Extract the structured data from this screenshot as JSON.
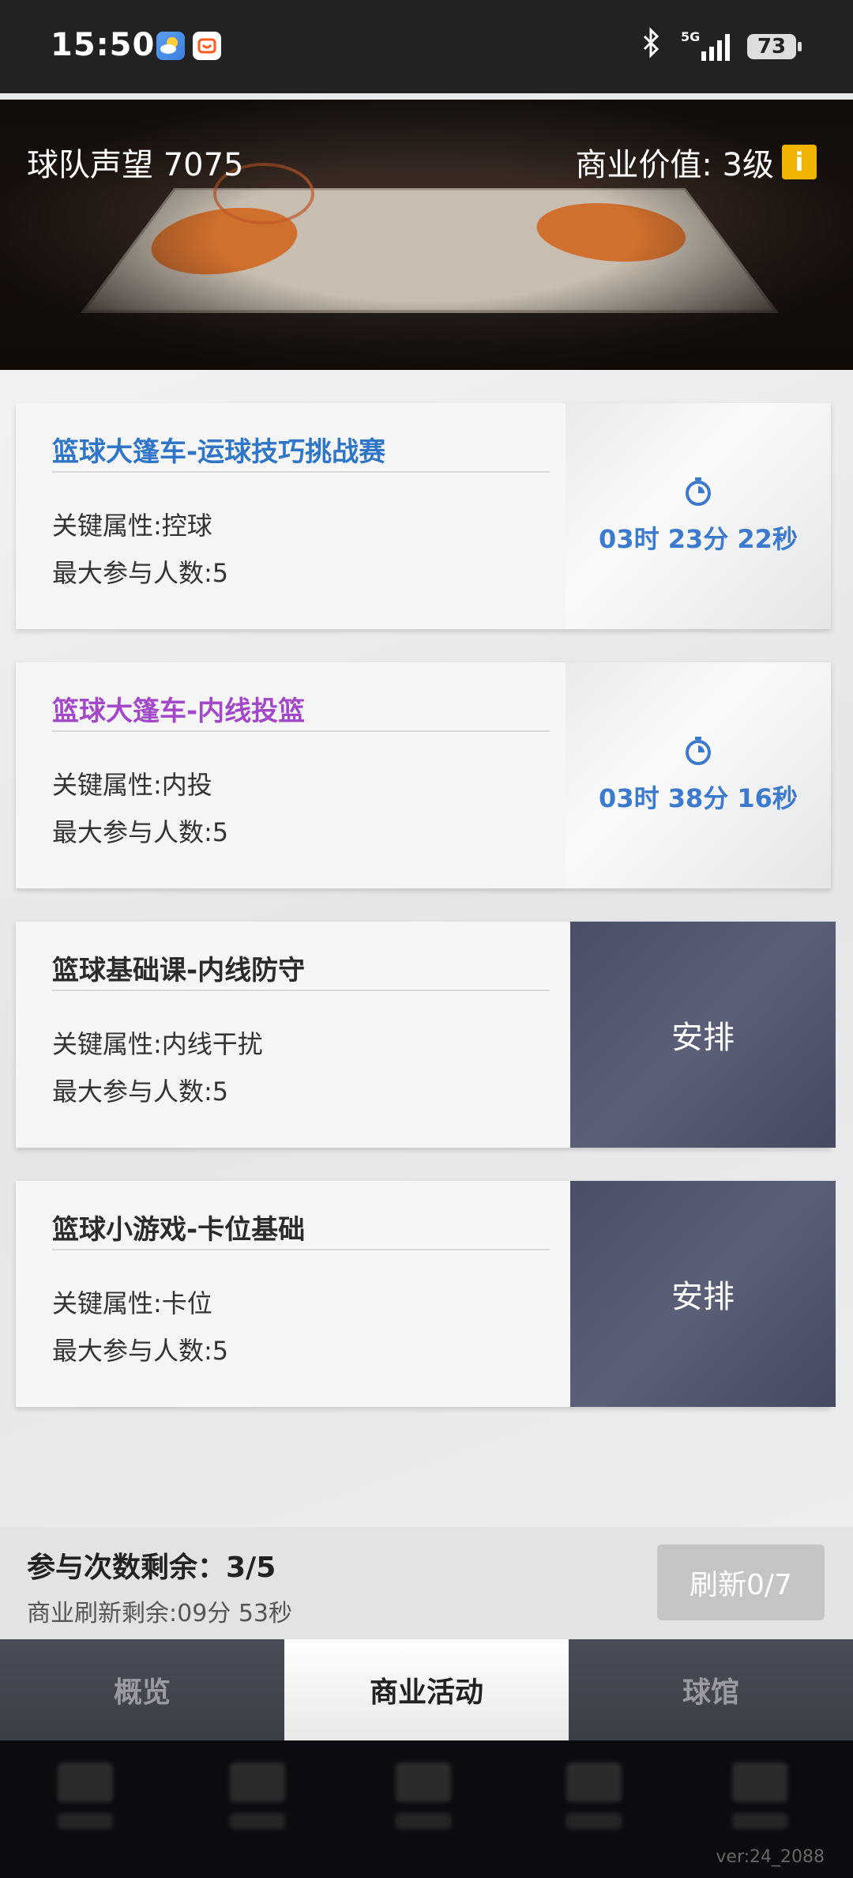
{
  "status_bar": {
    "time": "15:50",
    "network": "5G",
    "battery": "73",
    "icons": [
      "weather-app-icon",
      "taobao-app-icon",
      "bluetooth-icon",
      "signal-icon",
      "battery-icon"
    ]
  },
  "header": {
    "reputation": "球队声望 7075",
    "commercial_value": "商业价值: 3级",
    "info_icon": "i"
  },
  "cards": [
    {
      "title": "篮球大篷车-运球技巧挑战赛",
      "title_color": "#2f76c8",
      "attribute": "关键属性:控球",
      "max": "最大参与人数:5",
      "timer": "03时 23分 22秒"
    },
    {
      "title": "篮球大篷车-内线投篮",
      "title_color": "#a348c9",
      "attribute": "关键属性:内投",
      "max": "最大参与人数:5",
      "timer": "03时 38分 16秒"
    },
    {
      "title": "篮球基础课-内线防守",
      "title_color": "#2b2b2b",
      "attribute": "关键属性:内线干扰",
      "max": "最大参与人数:5",
      "button": "安排"
    },
    {
      "title": "篮球小游戏-卡位基础",
      "title_color": "#2b2b2b",
      "attribute": "关键属性:卡位",
      "max": "最大参与人数:5",
      "button": "安排"
    }
  ],
  "footer_info": {
    "participation": "参与次数剩余：3/5",
    "refresh_remaining": "商业刷新剩余:09分 53秒",
    "refresh_button": "刷新0/7"
  },
  "tabs": [
    {
      "label": "概览",
      "active": false
    },
    {
      "label": "商业活动",
      "active": true
    },
    {
      "label": "球馆",
      "active": false
    }
  ],
  "version": "ver:24_2088"
}
